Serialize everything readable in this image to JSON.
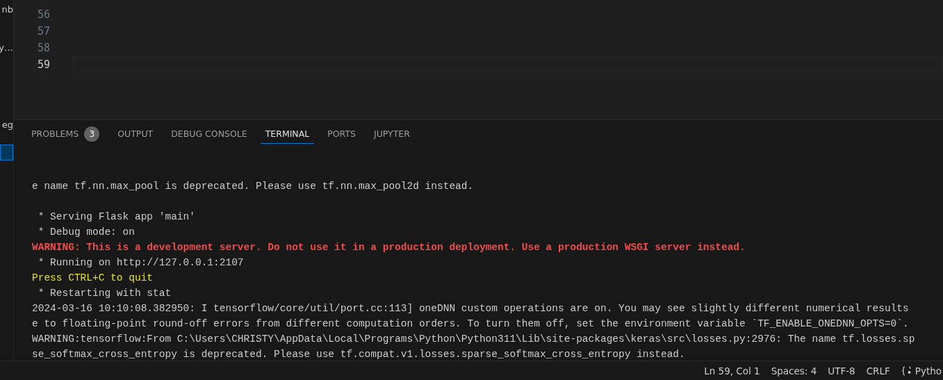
{
  "sidebar": {
    "items": [
      {
        "text": "nb",
        "selected": false
      },
      {
        "text": "y…",
        "selected": false
      },
      {
        "text": "eg",
        "selected": false
      },
      {
        "selected": true
      }
    ]
  },
  "editor": {
    "lines": [
      {
        "number": "56",
        "current": false
      },
      {
        "number": "57",
        "current": false
      },
      {
        "number": "58",
        "current": false
      },
      {
        "number": "59",
        "current": true
      }
    ]
  },
  "panel": {
    "tabs": [
      {
        "label": "PROBLEMS",
        "badge": "3",
        "selected": false
      },
      {
        "label": "OUTPUT",
        "selected": false
      },
      {
        "label": "DEBUG CONSOLE",
        "selected": false
      },
      {
        "label": "TERMINAL",
        "selected": true
      },
      {
        "label": "PORTS",
        "selected": false
      },
      {
        "label": "JUPYTER",
        "selected": false
      }
    ],
    "terminal": [
      {
        "kind": "normal",
        "text": "e name tf.nn.max_pool is deprecated. Please use tf.nn.max_pool2d instead."
      },
      {
        "kind": "blank"
      },
      {
        "kind": "normal",
        "text": " * Serving Flask app 'main'"
      },
      {
        "kind": "normal",
        "text": " * Debug mode: on"
      },
      {
        "kind": "warning",
        "text": "WARNING: This is a development server. Do not use it in a production deployment. Use a production WSGI server instead."
      },
      {
        "kind": "normal",
        "text": " * Running on http://127.0.0.1:2107"
      },
      {
        "kind": "prompt",
        "text": "Press CTRL+C to quit"
      },
      {
        "kind": "normal",
        "text": " * Restarting with stat"
      },
      {
        "kind": "normal",
        "text": "2024-03-16 10:10:08.382950: I tensorflow/core/util/port.cc:113] oneDNN custom operations are on. You may see slightly different numerical results"
      },
      {
        "kind": "normal",
        "text": "e to floating-point round-off errors from different computation orders. To turn them off, set the environment variable `TF_ENABLE_ONEDNN_OPTS=0`."
      },
      {
        "kind": "normal",
        "text": "WARNING:tensorflow:From C:\\Users\\CHRISTY\\AppData\\Local\\Programs\\Python\\Python311\\Lib\\site-packages\\keras\\src\\losses.py:2976: The name tf.losses.sp"
      },
      {
        "kind": "normal",
        "text": "se_softmax_cross_entropy is deprecated. Please use tf.compat.v1.losses.sparse_softmax_cross_entropy instead."
      }
    ]
  },
  "status_bar": {
    "items": [
      "Ln 59, Col 1",
      "Spaces: 4",
      "UTF-8",
      "CRLF"
    ],
    "language": "Pytho"
  }
}
